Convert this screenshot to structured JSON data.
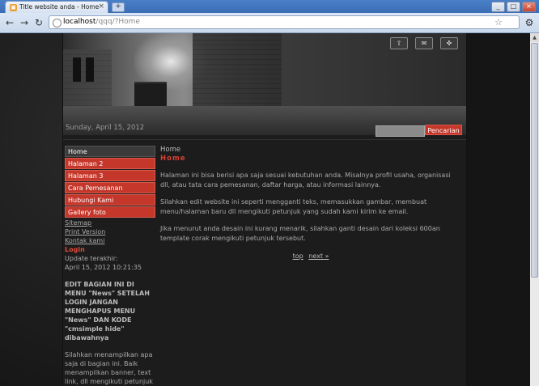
{
  "browser": {
    "tab_title": "Title website anda - Home",
    "tab_close": "×",
    "new_tab": "+",
    "url_host": "localhost",
    "url_path": "/qqq/?Home",
    "back": "←",
    "forward": "→",
    "reload": "↻",
    "star": "☆",
    "wrench": "🔧",
    "minimize": "_",
    "maximize": "□",
    "close": "×"
  },
  "header": {
    "date": "Sunday, April 15, 2012",
    "icons": [
      "⇧",
      "✉",
      "✜"
    ],
    "search_button": "Pencarian",
    "search_value": ""
  },
  "sidebar": {
    "menu": [
      {
        "label": "Home",
        "active": true
      },
      {
        "label": "Halaman 2",
        "active": false
      },
      {
        "label": "Halaman 3",
        "active": false
      },
      {
        "label": "Cara Pemesanan",
        "active": false
      },
      {
        "label": "Hubungi Kami",
        "active": false
      },
      {
        "label": "Gallery foto",
        "active": false
      }
    ],
    "links": [
      "Sitemap",
      "Print Version",
      "Kontak kami"
    ],
    "login": "Login",
    "update_label": "Update terakhir:",
    "update_time": "April 15, 2012 10:21:35",
    "notice": "EDIT BAGIAN INI DI MENU \"News\" SETELAH LOGIN JANGAN MENGHAPUS MENU \"News\" DAN KODE \"cmsimple hide\" dibawahnya",
    "notice_body": "Silahkan menampilkan apa saja di bagian ini. Baik menampilkan banner, text link, dll mengikuti petunjuk"
  },
  "content": {
    "breadcrumb": "Home",
    "title": "Home",
    "paragraphs": [
      "Halaman ini bisa berisi apa saja sesuai kebutuhan anda. Misalnya profil usaha, organisasi dll, atau tata cara pemesanan, daftar harga, atau informasi lainnya.",
      "Silahkan edit website ini seperti mengganti teks, memasukkan gambar, membuat menu/halaman baru dll mengikuti petunjuk yang sudah kami kirim ke email.",
      "Jika menurut anda desain ini kurang menarik, silahkan ganti desain dari koleksi 600an template corak mengikuti petunjuk tersebut."
    ],
    "pager_top": "top",
    "pager_next": "next »"
  }
}
